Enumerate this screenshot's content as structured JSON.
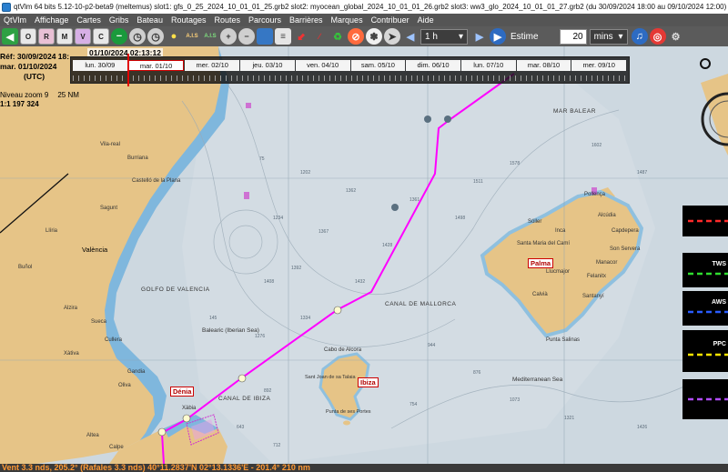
{
  "window": {
    "title": "qtVlm 64 bits 5.12-10-p2-beta9 (meltemus) slot1: gfs_0_25_2024_10_01_01_25.grb2 slot2: myocean_global_2024_10_01_01_26.grb2 slot3: ww3_glo_2024_10_01_01_27.grb2 (du 30/09/2024 18:00 au 09/10/2024 12:00)"
  },
  "menu": [
    "QtVlm",
    "Affichage",
    "Cartes",
    "Gribs",
    "Bateau",
    "Routages",
    "Routes",
    "Parcours",
    "Barrières",
    "Marques",
    "Contribuer",
    "Aide"
  ],
  "toolbar": {
    "letter_buttons": [
      "O",
      "R",
      "M",
      "V",
      "C"
    ],
    "label_ais": "A.I.S",
    "step_value": "1 h",
    "estime_label": "Estime",
    "estime_value": "20",
    "unit_value": "mins"
  },
  "timeline": {
    "days": [
      "lun. 30/09",
      "mar. 01/10",
      "mer. 02/10",
      "jeu. 03/10",
      "ven. 04/10",
      "sam. 05/10",
      "dim. 06/10",
      "lun. 07/10",
      "mar. 08/10",
      "mer. 09/10"
    ],
    "current_time": "01/10/2024 02:13:12"
  },
  "info": {
    "ref_line": "Réf: 30/09/2024 18:",
    "date_line": "mar. 01/10/2024",
    "tz_line": "(UTC)",
    "zoom_label": "Niveau zoom 9",
    "zoom_nm": "25 NM",
    "scale": "1:1 197 324"
  },
  "map_labels": {
    "valencia": "València",
    "golfo": "GOLFO DE VALENCIA",
    "canal_mallorca": "CANAL DE MALLORCA",
    "canal_ibiza": "CANAL DE IBIZA",
    "mar_balear": "MAR BALEAR",
    "balearic_sea": "Balearic (Iberian Sea)",
    "med_sea": "Mediterranean Sea",
    "castello": "Castelló de la Plana",
    "cabo_alcora": "Cabo de Alcora",
    "santa_maria": "Santa Maria del Camí",
    "puerto_pollensa": "Pollença",
    "son_servera": "Son Servera",
    "felanitx": "Felanitx",
    "santanyi": "Santanyí",
    "calviа": "Calvià",
    "llucmajor": "Llucmajor",
    "punta_salinas": "Punta Salinas",
    "sant_joan": "Sant Joan de sa Talaia",
    "punta_portes": "Punta de ses Portes",
    "cala_ratjada": "Capdepera",
    "alcudia": "Alcúdia",
    "manacor": "Manacor",
    "inca": "Inca",
    "soller": "Sóller",
    "calpe": "Calpe",
    "alicante": "Altea",
    "sagunto": "Sagunt",
    "benicasim": "Burriana",
    "vila_real": "Vila-real",
    "torrevieja": "Xàbia",
    "ondara": "Dénia",
    "gandia": "Gandia",
    "oliva": "Oliva",
    "alzira": "Alzira",
    "sueca": "Sueca",
    "cullera": "Cullera",
    "xativa": "Xàtiva",
    "lliria": "Llíria",
    "elx": "Buñol"
  },
  "cities": {
    "palma": "Palma",
    "ibiza": "Ibiza",
    "denia": "Dénia"
  },
  "legend": {
    "tws": "TWS",
    "aws": "AWS",
    "ppc": "PPC"
  },
  "status": {
    "text": "Vent 3.3 nds, 205.2° (Rafales 3.3 nds) 40°11.2837'N 02°13.1336'E - 201.4° 210 nm"
  },
  "colors": {
    "route": "#ff00ff",
    "land": "#e3c184",
    "sea": "#c9d5de",
    "deep": "#d2dbe2",
    "coast": "#4a8fc4"
  }
}
